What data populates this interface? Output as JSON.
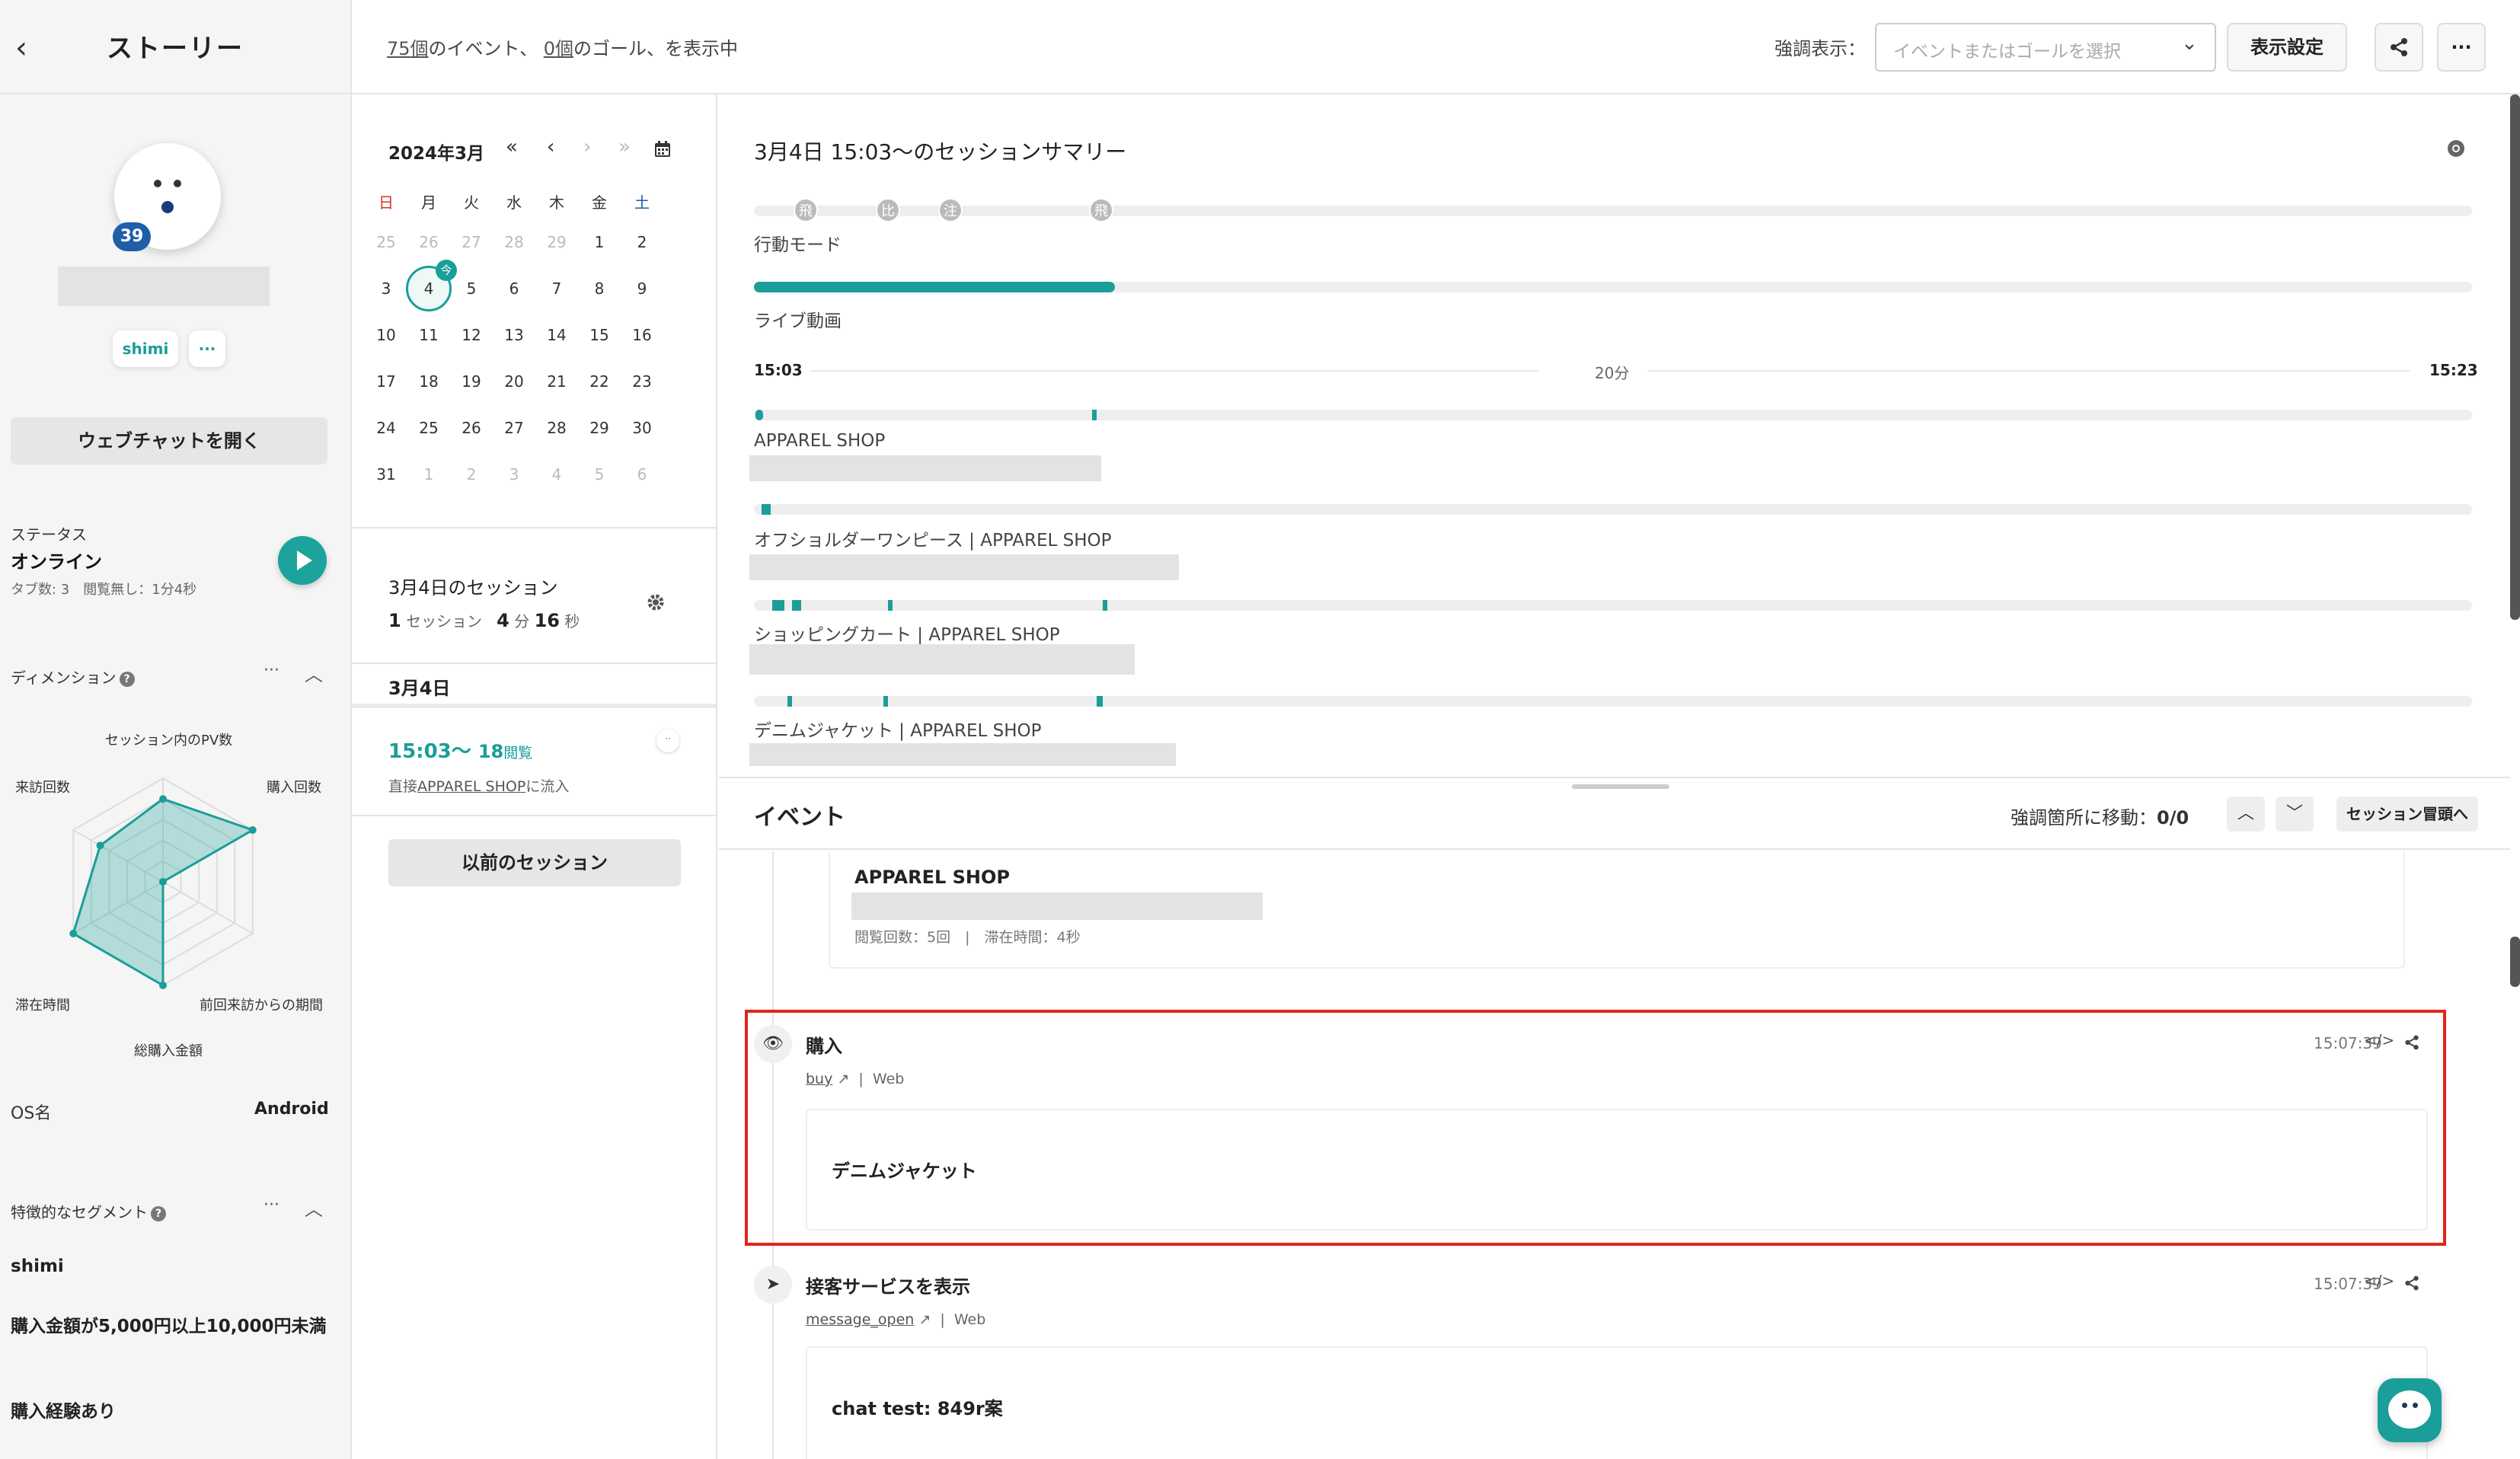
{
  "sidebar": {
    "back_icon": "chevron-left-icon",
    "title": "ストーリー",
    "visit_count": "39",
    "tag": "shimi",
    "more": "···",
    "webchat_button": "ウェブチャットを開く",
    "status_label": "ステータス",
    "status_value": "オンライン",
    "status_detail": "タブ数: 3　閲覧無し：1分4秒",
    "dimension_title": "ディメンション",
    "radar": {
      "axes": [
        "セッション内のPV数",
        "購入回数",
        "前回来訪からの期間",
        "総購入金額",
        "滞在時間",
        "来訪回数"
      ],
      "values": [
        0.8,
        1.0,
        0.0,
        1.0,
        1.0,
        0.7
      ]
    },
    "os_label": "OS名",
    "os_value": "Android",
    "segment_title": "特徴的なセグメント",
    "segments": [
      "shimi",
      "購入金額が5,000円以上10,000円未満",
      "購入経験あり"
    ]
  },
  "topbar": {
    "summary_count_events": "75個",
    "summary_text_events": "のイベント、",
    "summary_count_goals": "0個",
    "summary_text_goals": "のゴール、を表示中",
    "highlight_label": "強調表示：",
    "highlight_placeholder": "イベントまたはゴールを選択",
    "display_settings": "表示設定",
    "share_icon": "share-icon",
    "more": "···"
  },
  "calendar": {
    "month": "2024年3月",
    "nav": [
      "«",
      "‹",
      "›",
      "»"
    ],
    "weekdays": [
      "日",
      "月",
      "火",
      "水",
      "木",
      "金",
      "土"
    ],
    "weeks": [
      [
        "25",
        "26",
        "27",
        "28",
        "29",
        "1",
        "2"
      ],
      [
        "3",
        "4",
        "5",
        "6",
        "7",
        "8",
        "9"
      ],
      [
        "10",
        "11",
        "12",
        "13",
        "14",
        "15",
        "16"
      ],
      [
        "17",
        "18",
        "19",
        "20",
        "21",
        "22",
        "23"
      ],
      [
        "24",
        "25",
        "26",
        "27",
        "28",
        "29",
        "30"
      ],
      [
        "31",
        "1",
        "2",
        "3",
        "4",
        "5",
        "6"
      ]
    ],
    "today_badge": "今",
    "colors": {
      "accent": "#1a9e99",
      "sunday": "#d93025",
      "saturday": "#1f5ea8"
    }
  },
  "sessions": {
    "title": "3月4日のセッション",
    "count_num": "1",
    "count_unit": "セッション",
    "duration_min": "4",
    "duration_min_unit": "分",
    "duration_sec": "16",
    "duration_sec_unit": "秒",
    "date_header": "3月4日",
    "item_time": "15:03〜",
    "item_views": "18",
    "item_views_unit": "閲覧",
    "item_source_prefix": "直接",
    "item_source_link": "APPAREL SHOP",
    "item_source_suffix": "に流入",
    "previous_button": "以前のセッション"
  },
  "summary": {
    "title": "3月4日 15:03〜のセッションサマリー",
    "behavior_label": "行動モード",
    "behavior_badges": [
      "飛",
      "比",
      "注",
      "飛"
    ],
    "live_label": "ライブ動画",
    "live_progress": 0.21,
    "time_start": "15:03",
    "time_mid": "20分",
    "time_end": "15:23",
    "pages": [
      {
        "title": "APPAREL SHOP"
      },
      {
        "title": "オフショルダーワンピース | APPAREL SHOP"
      },
      {
        "title": "ショッピングカート | APPAREL SHOP"
      },
      {
        "title": "デニムジャケット | APPAREL SHOP"
      }
    ]
  },
  "events": {
    "title": "イベント",
    "jump_label": "強調箇所に移動：",
    "jump_count": "0/0",
    "to_start": "セッション冒頭へ",
    "prev_card": {
      "title": "APPAREL SHOP",
      "meta": "閲覧回数：5回　|　滞在時間：4秒"
    },
    "items": [
      {
        "icon": "eye-icon",
        "title": "購入",
        "time": "15:07:39",
        "link": "buy",
        "channel": "Web",
        "content": "デニムジャケット"
      },
      {
        "icon": "send-icon",
        "title": "接客サービスを表示",
        "time": "15:07:39",
        "link": "message_open",
        "channel": "Web",
        "content": "chat test: 849r案"
      }
    ],
    "highlight_color": "#e0261b"
  }
}
